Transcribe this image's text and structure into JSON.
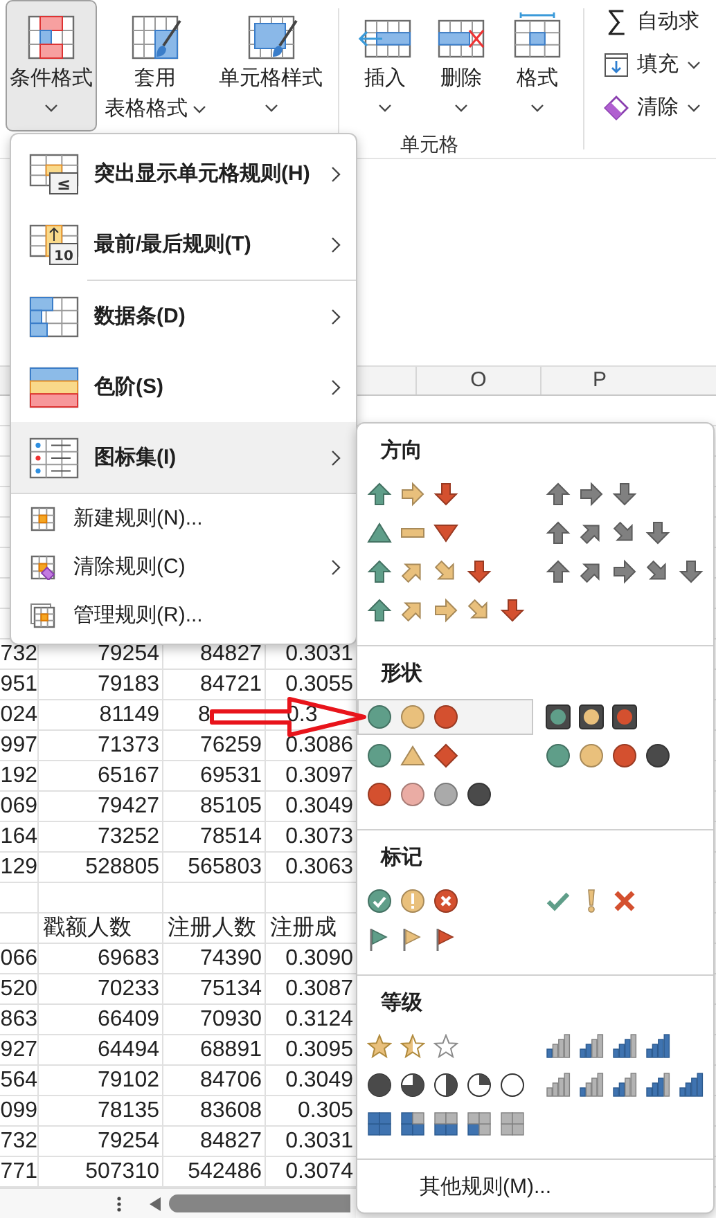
{
  "ribbon": {
    "style_group": [
      {
        "lines": [
          "条件格式"
        ],
        "pressed": true
      },
      {
        "lines": [
          "套用",
          "表格格式"
        ],
        "pressed": false
      },
      {
        "lines": [
          "单元格样式"
        ],
        "pressed": false
      }
    ],
    "cells_group": {
      "buttons": [
        {
          "label": "插入"
        },
        {
          "label": "删除"
        },
        {
          "label": "格式"
        }
      ],
      "group_label": "单元格"
    },
    "editing_group": [
      {
        "kind": "sum",
        "symbol": "∑",
        "label": "自动求"
      },
      {
        "kind": "fill",
        "label": "填充"
      },
      {
        "kind": "clear",
        "label": "清除"
      }
    ]
  },
  "sheet": {
    "column_headers": [
      "O",
      "P"
    ],
    "table_1_rows": [
      {
        "cells": [
          "732",
          "79254",
          "84827",
          "0.3031"
        ],
        "under_annotation": false
      },
      {
        "cells": [
          "951",
          "79183",
          "84721",
          "0.3055"
        ],
        "under_annotation": false
      },
      {
        "cells": [
          "024",
          "81149",
          "8",
          "0.3"
        ],
        "under_annotation": true
      },
      {
        "cells": [
          "997",
          "71373",
          "76259",
          "0.3086"
        ],
        "under_annotation": false
      },
      {
        "cells": [
          "192",
          "65167",
          "69531",
          "0.3097"
        ],
        "under_annotation": false
      },
      {
        "cells": [
          "069",
          "79427",
          "85105",
          "0.3049"
        ],
        "under_annotation": false
      },
      {
        "cells": [
          "164",
          "73252",
          "78514",
          "0.3073"
        ],
        "under_annotation": false
      },
      {
        "cells": [
          "129",
          "528805",
          "565803",
          "0.3063"
        ],
        "under_annotation": false
      }
    ],
    "table_2_header": [
      "戳额人数",
      "注册人数",
      "注册成"
    ],
    "table_2_rows": [
      [
        "066",
        "69683",
        "74390",
        "0.3090"
      ],
      [
        "520",
        "70233",
        "75134",
        "0.3087"
      ],
      [
        "863",
        "66409",
        "70930",
        "0.3124"
      ],
      [
        "927",
        "64494",
        "68891",
        "0.3095"
      ],
      [
        "564",
        "79102",
        "84706",
        "0.3049"
      ],
      [
        "099",
        "78135",
        "83608",
        "0.305"
      ],
      [
        "732",
        "79254",
        "84827",
        "0.3031"
      ],
      [
        "771",
        "507310",
        "542486",
        "0.3074"
      ]
    ]
  },
  "conditional_formatting_menu": {
    "items": [
      {
        "kind": "large",
        "label": "突出显示单元格规则(H)",
        "icon_text": "≤",
        "submenu": true,
        "selected": false
      },
      {
        "kind": "large",
        "label": "最前/最后规则(T)",
        "icon_text": "10",
        "submenu": true,
        "selected": false
      },
      {
        "kind": "separator"
      },
      {
        "kind": "large",
        "label": "数据条(D)",
        "submenu": true,
        "selected": false
      },
      {
        "kind": "large",
        "label": "色阶(S)",
        "submenu": true,
        "selected": false
      },
      {
        "kind": "large",
        "label": "图标集(I)",
        "submenu": true,
        "selected": true
      },
      {
        "kind": "separator"
      },
      {
        "kind": "small",
        "label": "新建规则(N)...",
        "submenu": false,
        "selected": false
      },
      {
        "kind": "small",
        "label": "清除规则(C)",
        "submenu": true,
        "selected": false
      },
      {
        "kind": "small",
        "label": "管理规则(R)...",
        "submenu": false,
        "selected": false
      }
    ]
  },
  "icon_sets_menu": {
    "sections": [
      {
        "title": "方向",
        "sets": [
          {
            "selected": false,
            "icons": [
              {
                "kind": "arrow_up",
                "color": "#5f9e89"
              },
              {
                "kind": "arrow_right",
                "color": "#e9c07c"
              },
              {
                "kind": "arrow_down",
                "color": "#d4502f"
              }
            ]
          },
          {
            "selected": false,
            "icons": [
              {
                "kind": "arrow_up",
                "color": "#808080"
              },
              {
                "kind": "arrow_right",
                "color": "#808080"
              },
              {
                "kind": "arrow_down",
                "color": "#808080"
              }
            ]
          },
          {
            "selected": false,
            "icons": [
              {
                "kind": "tri_up",
                "color": "#5f9e89"
              },
              {
                "kind": "dash",
                "color": "#e9c07c"
              },
              {
                "kind": "tri_down",
                "color": "#d4502f"
              }
            ]
          },
          {
            "selected": false,
            "icons": [
              {
                "kind": "arrow_up",
                "color": "#808080"
              },
              {
                "kind": "arrow_upright",
                "color": "#808080"
              },
              {
                "kind": "arrow_downright",
                "color": "#808080"
              },
              {
                "kind": "arrow_down",
                "color": "#808080"
              }
            ]
          },
          {
            "selected": false,
            "icons": [
              {
                "kind": "arrow_up",
                "color": "#5f9e89"
              },
              {
                "kind": "arrow_upright",
                "color": "#e9c07c"
              },
              {
                "kind": "arrow_downright",
                "color": "#e9c07c"
              },
              {
                "kind": "arrow_down",
                "color": "#d4502f"
              }
            ]
          },
          {
            "selected": false,
            "icons": [
              {
                "kind": "arrow_up",
                "color": "#808080"
              },
              {
                "kind": "arrow_upright",
                "color": "#808080"
              },
              {
                "kind": "arrow_right",
                "color": "#808080"
              },
              {
                "kind": "arrow_downright",
                "color": "#808080"
              },
              {
                "kind": "arrow_down",
                "color": "#808080"
              }
            ]
          },
          {
            "selected": false,
            "icons": [
              {
                "kind": "arrow_up",
                "color": "#5f9e89"
              },
              {
                "kind": "arrow_upright",
                "color": "#e9c07c"
              },
              {
                "kind": "arrow_right",
                "color": "#e9c07c"
              },
              {
                "kind": "arrow_downright",
                "color": "#e9c07c"
              },
              {
                "kind": "arrow_down",
                "color": "#d4502f"
              }
            ]
          }
        ]
      },
      {
        "title": "形状",
        "sets": [
          {
            "selected": true,
            "icons": [
              {
                "kind": "circle",
                "color": "#5f9e89"
              },
              {
                "kind": "circle",
                "color": "#e9c07c"
              },
              {
                "kind": "circle",
                "color": "#d4502f"
              }
            ]
          },
          {
            "selected": false,
            "icons": [
              {
                "kind": "light",
                "color": "#5f9e89"
              },
              {
                "kind": "light",
                "color": "#e9c07c"
              },
              {
                "kind": "light",
                "color": "#d4502f"
              }
            ]
          },
          {
            "selected": false,
            "icons": [
              {
                "kind": "circle",
                "color": "#5f9e89"
              },
              {
                "kind": "triangle",
                "color": "#e9c07c"
              },
              {
                "kind": "diamond",
                "color": "#d4502f"
              }
            ]
          },
          {
            "selected": false,
            "icons": [
              {
                "kind": "circle",
                "color": "#5f9e89"
              },
              {
                "kind": "circle",
                "color": "#e9c07c"
              },
              {
                "kind": "circle",
                "color": "#d4502f"
              },
              {
                "kind": "circle",
                "color": "#4a4a4a"
              }
            ]
          },
          {
            "selected": false,
            "icons": [
              {
                "kind": "circle",
                "color": "#d4502f"
              },
              {
                "kind": "circle",
                "color": "#eaaca4"
              },
              {
                "kind": "circle",
                "color": "#aaaaaa"
              },
              {
                "kind": "circle",
                "color": "#4a4a4a"
              }
            ]
          }
        ]
      },
      {
        "title": "标记",
        "sets": [
          {
            "selected": false,
            "icons": [
              {
                "kind": "check_circle",
                "color": "#5f9e89"
              },
              {
                "kind": "excl_circle",
                "color": "#e9c07c"
              },
              {
                "kind": "x_circle",
                "color": "#d4502f"
              }
            ]
          },
          {
            "selected": false,
            "icons": [
              {
                "kind": "check",
                "color": "#5f9e89"
              },
              {
                "kind": "excl",
                "color": "#e9c07c"
              },
              {
                "kind": "cross",
                "color": "#d4502f"
              }
            ]
          },
          {
            "selected": false,
            "icons": [
              {
                "kind": "flag",
                "color": "#5f9e89"
              },
              {
                "kind": "flag",
                "color": "#e9c07c"
              },
              {
                "kind": "flag",
                "color": "#d4502f"
              }
            ]
          }
        ]
      },
      {
        "title": "等级",
        "sets": [
          {
            "selected": false,
            "icons": [
              {
                "kind": "star_full"
              },
              {
                "kind": "star_half"
              },
              {
                "kind": "star_empty"
              }
            ]
          },
          {
            "selected": false,
            "icons": [
              {
                "kind": "signal_1"
              },
              {
                "kind": "signal_2"
              },
              {
                "kind": "signal_3"
              },
              {
                "kind": "signal_4"
              }
            ]
          },
          {
            "selected": false,
            "icons": [
              {
                "kind": "pie_full"
              },
              {
                "kind": "pie_three_quarters"
              },
              {
                "kind": "pie_half"
              },
              {
                "kind": "pie_quarter"
              },
              {
                "kind": "pie_empty"
              }
            ]
          },
          {
            "selected": false,
            "icons": [
              {
                "kind": "signal_0"
              },
              {
                "kind": "signal_1"
              },
              {
                "kind": "signal_2"
              },
              {
                "kind": "signal_3"
              },
              {
                "kind": "signal_4"
              }
            ]
          },
          {
            "selected": false,
            "icons": [
              {
                "kind": "quad_4"
              },
              {
                "kind": "quad_3"
              },
              {
                "kind": "quad_2"
              },
              {
                "kind": "quad_1"
              },
              {
                "kind": "quad_0"
              }
            ]
          }
        ]
      }
    ],
    "footer": "其他规则(M)..."
  }
}
